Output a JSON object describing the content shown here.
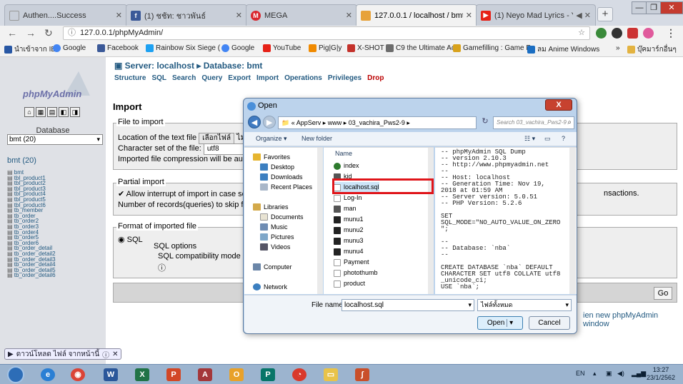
{
  "browser": {
    "tabs": [
      {
        "title": "Authen....Success",
        "fav": "",
        "fav_color": "#c9cfd9"
      },
      {
        "title": "(1) ชช้ท: ชาวพันธ์",
        "fav": "f",
        "fav_color": "#3b5998"
      },
      {
        "title": "MEGA",
        "fav": "M",
        "fav_color": "#d9272e"
      },
      {
        "title": "127.0.0.1 / localhost / bmt | php",
        "fav": "",
        "fav_color": "#e7a23a"
      },
      {
        "title": "(1) Neyo Mad Lyrics - YouT",
        "fav": "▶",
        "fav_color": "#e62117"
      }
    ],
    "url": "127.0.0.1/phpMyAdmin/",
    "bookmarks": [
      "นำเข้าจาก IE",
      "Google",
      "Facebook",
      "Rainbow Six Siege (",
      "Google",
      "YouTube",
      "Pig|G|y",
      "X-SHOT",
      "C9 the Ultimate Acti",
      "Gamefilling : Game F",
      "ลม Anime Windows",
      "»",
      "บุ๊คมาร์กอื่นๆ"
    ]
  },
  "pma": {
    "logo": "phpMyAdmin",
    "breadcrumb": "Server: localhost ▸ Database: bmt",
    "tabs": [
      "Structure",
      "SQL",
      "Search",
      "Query",
      "Export",
      "Import",
      "Operations",
      "Privileges",
      "Drop"
    ],
    "db_label": "Database",
    "db_select": "bmt (20)",
    "db_link": "bmt (20)",
    "tables": [
      "bmt",
      "tbl_product1",
      "tbl_product2",
      "tbl_product3",
      "tbl_product4",
      "tbl_product5",
      "tbl_product6",
      "tb_member",
      "tb_order",
      "tb_order2",
      "tb_order3",
      "tb_order4",
      "tb_order5",
      "tb_order6",
      "tb_order_detail",
      "tb_order_detail2",
      "tb_order_detail3",
      "tb_order_detail4",
      "tb_order_detail5",
      "tb_order_detail6"
    ],
    "import_heading": "Import",
    "file_legend": "File to import",
    "file_location": "Location of the text file",
    "choose_file": "เลือกไฟล์",
    "choose_file_suffix": "ไม",
    "charset_label": "Character set of the file:",
    "charset_value": "utf8",
    "compression": "Imported file compression will be autom",
    "partial_legend": "Partial import",
    "allow_interrupt": "Allow interrupt of import in case sc",
    "allow_interrupt_tail": "nsactions.",
    "skip_records": "Number of records(queries) to skip fro",
    "format_legend": "Format of imported file",
    "format_sql": "SQL",
    "sql_options": "SQL options",
    "sql_compat": "SQL compatibility mode",
    "go": "Go",
    "open_window": "ien new phpMyAdmin window",
    "bottom_tab": "ดาวน์โหลด ไฟล์ จากหน้านี้"
  },
  "dialog": {
    "title": "Open",
    "close": "X",
    "path": "« AppServ ▸ www ▸ 03_vachira_Pws2-9 ▸",
    "search_placeholder": "Search 03_vachira_Pws2-9",
    "organize": "Organize ▾",
    "new_folder": "New folder",
    "nav": {
      "favorites": "Favorites",
      "desktop": "Desktop",
      "downloads": "Downloads",
      "recent": "Recent Places",
      "libraries": "Libraries",
      "documents": "Documents",
      "music": "Music",
      "pictures": "Pictures",
      "videos": "Videos",
      "computer": "Computer",
      "network": "Network"
    },
    "column_name": "Name",
    "files": [
      {
        "name": "index",
        "color": "#2d7a2d"
      },
      {
        "name": "kid",
        "color": "#555"
      },
      {
        "name": "localhost.sql",
        "color": "#9aa"
      },
      {
        "name": "Log-In",
        "color": "#9aa"
      },
      {
        "name": "man",
        "color": "#555"
      },
      {
        "name": "munu1",
        "color": "#222"
      },
      {
        "name": "munu2",
        "color": "#222"
      },
      {
        "name": "munu3",
        "color": "#222"
      },
      {
        "name": "munu4",
        "color": "#222"
      },
      {
        "name": "Payment",
        "color": "#9aa"
      },
      {
        "name": "photothumb",
        "color": "#9aa"
      },
      {
        "name": "product",
        "color": "#9aa"
      }
    ],
    "preview": "-- phpMyAdmin SQL Dump\n-- version 2.10.3\n-- http://www.phpmyadmin.net\n--\n-- Host: localhost\n-- Generation Time: Nov 19,\n2018 at 01:59 AM\n-- Server version: 5.0.51\n-- PHP Version: 5.2.6\n\nSET\nSQL_MODE=\"NO_AUTO_VALUE_ON_ZERO\n\";\n\n--\n-- Database: `nba`\n--\n\nCREATE DATABASE `nba` DEFAULT\nCHARACTER SET utf8 COLLATE utf8\n_unicode_ci;\nUSE `nba`;\n\n--",
    "file_name_label": "File name:",
    "file_name": "localhost.sql",
    "file_type": "ไฟล์ทั้งหมด",
    "open": "Open",
    "cancel": "Cancel"
  },
  "taskbar": {
    "lang": "EN",
    "time": "13:27",
    "date": "23/1/2562"
  }
}
